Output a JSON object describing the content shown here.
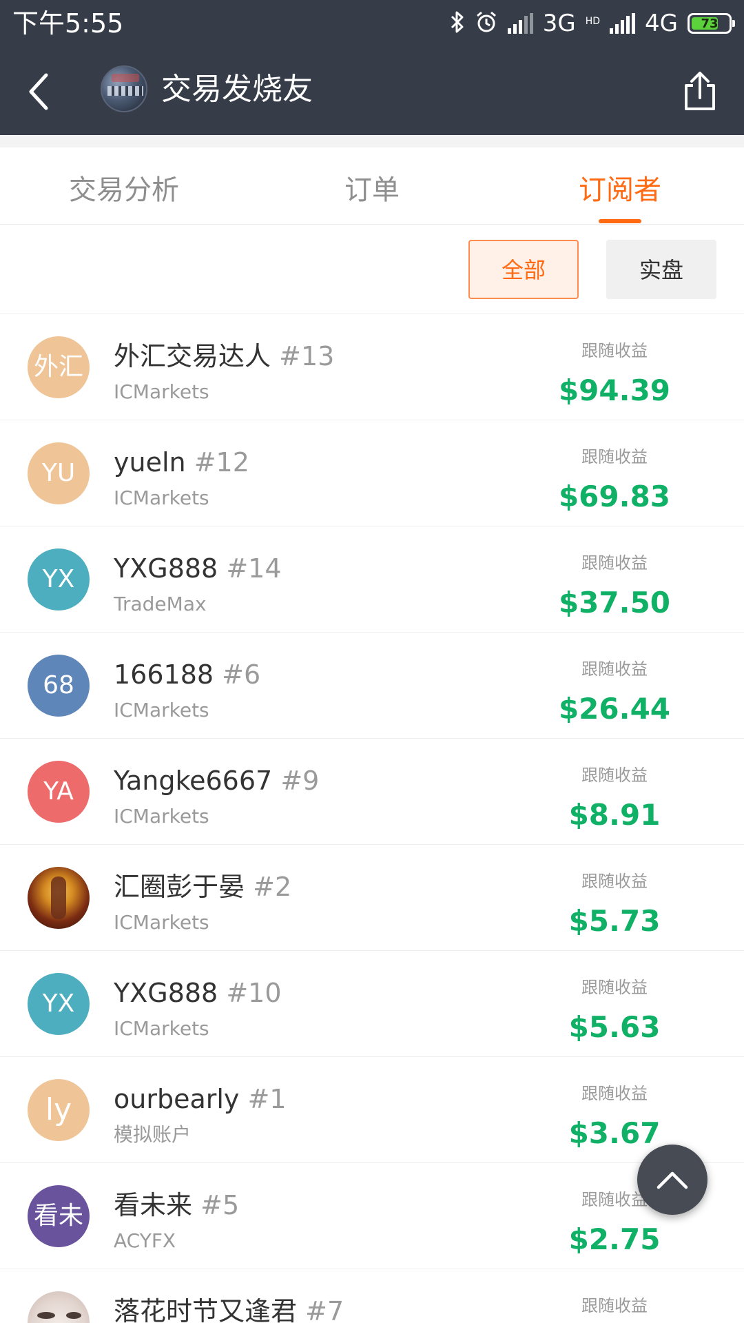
{
  "status_bar": {
    "time": "下午5:55",
    "network_3g": "3G",
    "network_hd": "HD",
    "network_4g": "4G",
    "battery": "73",
    "battery_level": 0.73
  },
  "header": {
    "title": "交易发烧友"
  },
  "tabs": [
    {
      "label": "交易分析",
      "active": false
    },
    {
      "label": "订单",
      "active": false
    },
    {
      "label": "订阅者",
      "active": true
    }
  ],
  "filters": {
    "all_label": "全部",
    "real_label": "实盘",
    "selected": "全部"
  },
  "subscribers": [
    {
      "avatar_text": "外汇",
      "avatar_color": "#efc497",
      "name": "外汇交易达人",
      "rank": "#13",
      "broker": "ICMarkets",
      "return_label": "跟随收益",
      "return_value": "$94.39"
    },
    {
      "avatar_text": "YU",
      "avatar_color": "#efc497",
      "name": "yueln",
      "rank": "#12",
      "broker": "ICMarkets",
      "return_label": "跟随收益",
      "return_value": "$69.83"
    },
    {
      "avatar_text": "YX",
      "avatar_color": "#4caebf",
      "name": "YXG888",
      "rank": "#14",
      "broker": "TradeMax",
      "return_label": "跟随收益",
      "return_value": "$37.50"
    },
    {
      "avatar_text": "68",
      "avatar_color": "#5f86b8",
      "name": "166188",
      "rank": "#6",
      "broker": "ICMarkets",
      "return_label": "跟随收益",
      "return_value": "$26.44"
    },
    {
      "avatar_text": "YA",
      "avatar_color": "#ee6b6b",
      "name": "Yangke6667",
      "rank": "#9",
      "broker": "ICMarkets",
      "return_label": "跟随收益",
      "return_value": "$8.91"
    },
    {
      "avatar_text": "",
      "avatar_color": "#b45f1a",
      "name": "汇圈彭于晏",
      "rank": "#2",
      "broker": "ICMarkets",
      "return_label": "跟随收益",
      "return_value": "$5.73"
    },
    {
      "avatar_text": "YX",
      "avatar_color": "#4caebf",
      "name": "YXG888",
      "rank": "#10",
      "broker": "ICMarkets",
      "return_label": "跟随收益",
      "return_value": "$5.63"
    },
    {
      "avatar_text": "ly",
      "avatar_color": "#efc497",
      "name": "ourbearly",
      "rank": "#1",
      "broker": "模拟账户",
      "return_label": "跟随收益",
      "return_value": "$3.67"
    },
    {
      "avatar_text": "看未",
      "avatar_color": "#6a539d",
      "name": "看未来",
      "rank": "#5",
      "broker": "ACYFX",
      "return_label": "跟随收益",
      "return_value": "$2.75"
    },
    {
      "avatar_text": "",
      "avatar_color": "#e8dcd6",
      "name": "落花时节又逢君",
      "rank": "#7",
      "broker": "",
      "return_label": "跟随收益",
      "return_value": ""
    }
  ],
  "icons": {
    "back": "chevron-left-icon",
    "share": "share-icon",
    "scroll_top": "chevron-up-icon",
    "bluetooth": "bluetooth-icon",
    "alarm": "alarm-icon"
  }
}
